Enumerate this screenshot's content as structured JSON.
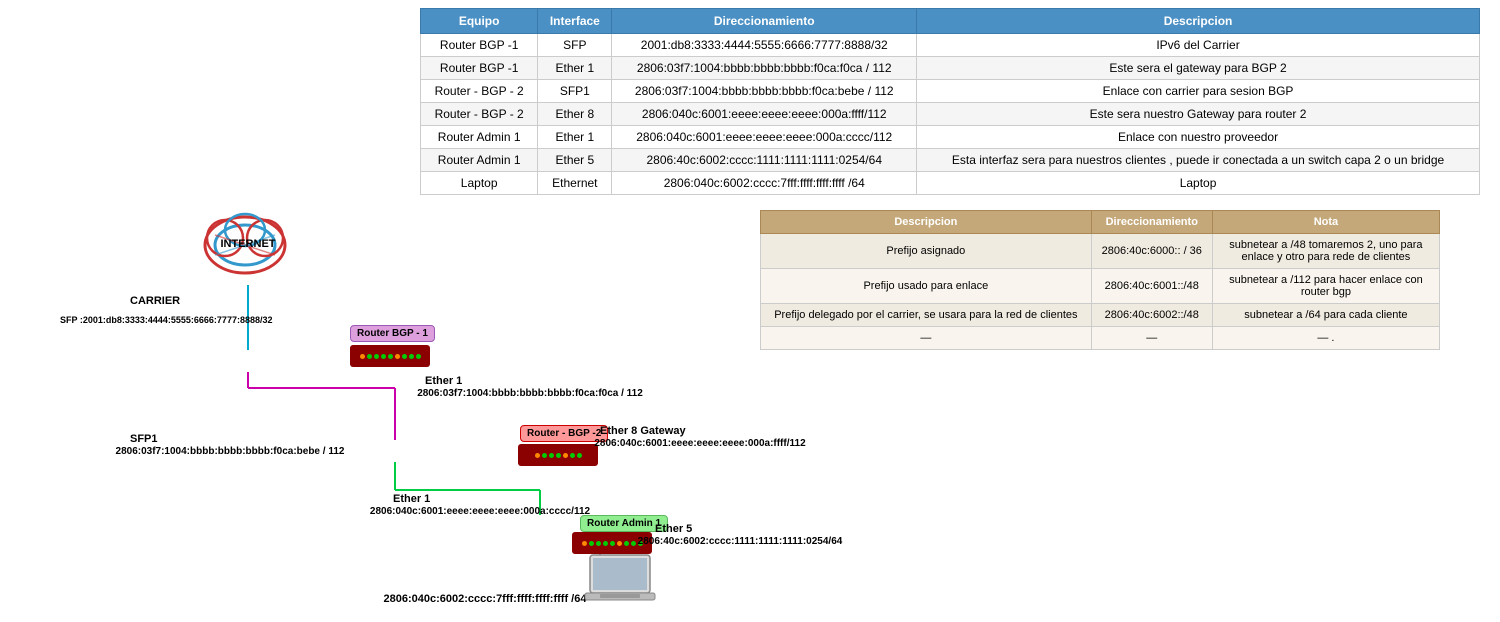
{
  "mainTable": {
    "headers": [
      "Equipo",
      "Interface",
      "Direccionamiento",
      "Descripcion"
    ],
    "rows": [
      {
        "equipo": "Router BGP -1",
        "interface": "SFP",
        "direccionamiento": "2001:db8:3333:4444:5555:6666:7777:8888/32",
        "descripcion": "IPv6 del Carrier"
      },
      {
        "equipo": "Router BGP -1",
        "interface": "Ether 1",
        "direccionamiento": "2806:03f7:1004:bbbb:bbbb:bbbb:f0ca:f0ca / 112",
        "descripcion": "Este sera el gateway para BGP 2"
      },
      {
        "equipo": "Router - BGP - 2",
        "interface": "SFP1",
        "direccionamiento": "2806:03f7:1004:bbbb:bbbb:bbbb:f0ca:bebe / 112",
        "descripcion": "Enlace con carrier para sesion BGP"
      },
      {
        "equipo": "Router - BGP - 2",
        "interface": "Ether 8",
        "direccionamiento": "2806:040c:6001:eeee:eeee:eeee:000a:ffff/112",
        "descripcion": "Este sera nuestro Gateway para router 2"
      },
      {
        "equipo": "Router Admin 1",
        "interface": "Ether 1",
        "direccionamiento": "2806:040c:6001:eeee:eeee:eeee:000a:cccc/112",
        "descripcion": "Enlace con nuestro proveedor"
      },
      {
        "equipo": "Router Admin 1",
        "interface": "Ether 5",
        "direccionamiento": "2806:40c:6002:cccc:1111:1111:1111:0254/64",
        "descripcion": "Esta interfaz sera para nuestros clientes , puede ir conectada a un switch capa 2 o un bridge"
      },
      {
        "equipo": "Laptop",
        "interface": "Ethernet",
        "direccionamiento": "2806:040c:6002:cccc:7fff:ffff:ffff:ffff /64",
        "descripcion": "Laptop"
      }
    ]
  },
  "secondaryTable": {
    "headers": [
      "Descripcion",
      "Direccionamiento",
      "Nota"
    ],
    "rows": [
      {
        "descripcion": "Prefijo asignado",
        "direccionamiento": "2806:40c:6000:: / 36",
        "nota": "subnetear a /48  tomaremos 2, uno para enlace y otro para rede de clientes"
      },
      {
        "descripcion": "Prefijo usado para enlace",
        "direccionamiento": "2806:40c:6001::/48",
        "nota": "subnetear a /112 para hacer enlace con router bgp"
      },
      {
        "descripcion": "Prefijo delegado por el carrier, se usara para la red de clientes",
        "direccionamiento": "2806:40c:6002::/48",
        "nota": "subnetear a /64 para cada cliente"
      },
      {
        "descripcion": "—",
        "direccionamiento": "—",
        "nota": "— ."
      }
    ]
  },
  "diagram": {
    "internetLabel": "INTERNET",
    "carrierLabel": "CARRIER",
    "carrierSfp": "SFP :2001:db8:3333:4444:5555:6666:7777:8888/32",
    "routerBgp1Label": "Router BGP -\n1",
    "routerBgp2Label": "Router - BGP -2",
    "routerAdmin1Label": "Router Admin 1",
    "ether1BgpLabel": "Ether 1",
    "ether1BgpIp": "2806:03f7:1004:bbbb:bbbb:bbbb:f0ca:f0ca / 112",
    "sfp1Label": "SFP1",
    "sfp1Ip": "2806:03f7:1004:bbbb:bbbb:bbbb:f0ca:bebe / 112",
    "ether8Label": "Ether 8 Gateway",
    "ether8Ip": "2806:040c:6001:eeee:eeee:eeee:000a:ffff/112",
    "ether1AdminLabel": "Ether 1",
    "ether1AdminIp": "2806:040c:6001:eeee:eeee:eeee:000a:cccc/112",
    "ether5Label": "Ether 5",
    "ether5Ip": "2806:40c:6002:cccc:1111:1111:1111:0254/64",
    "laptopIp": "2806:040c:6002:cccc:7fff:ffff:ffff:ffff /64"
  }
}
